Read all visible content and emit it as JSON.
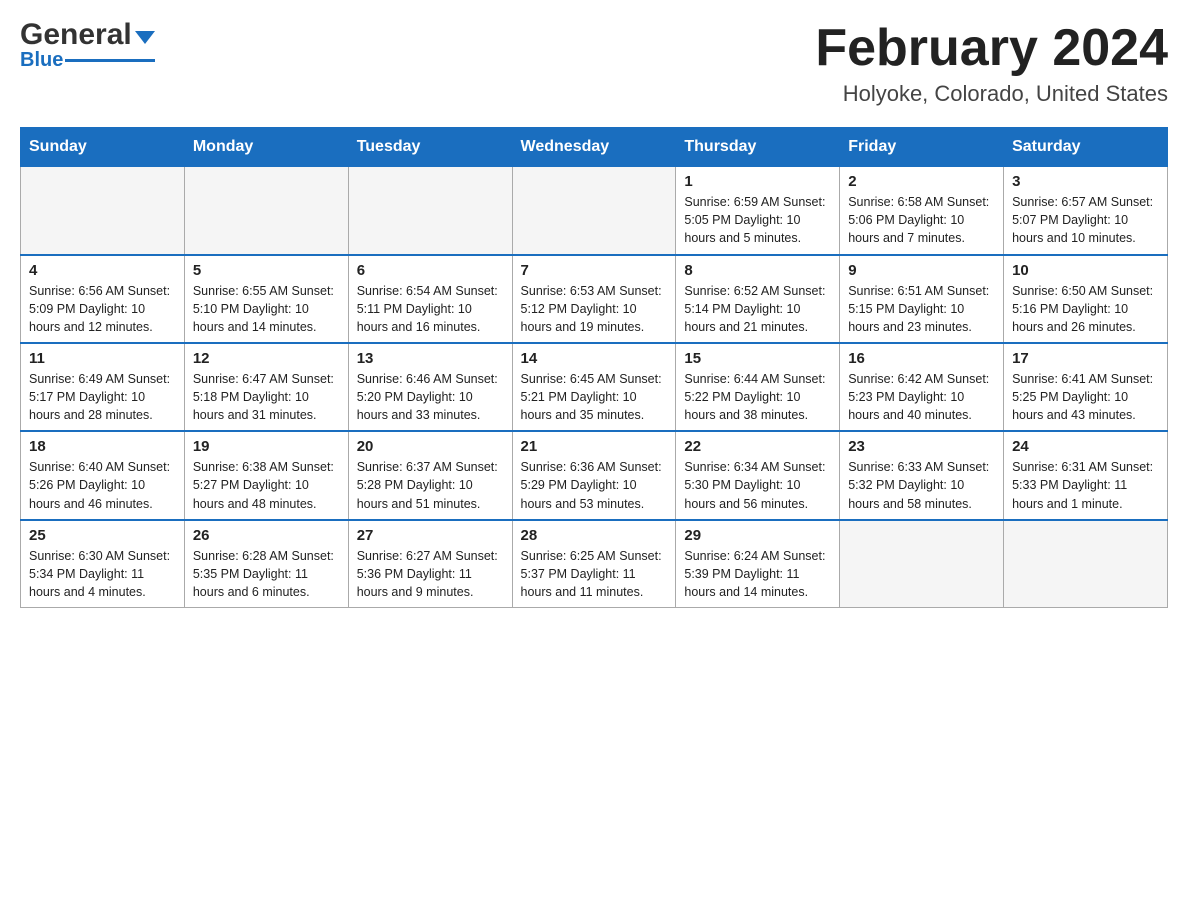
{
  "header": {
    "logo": {
      "general": "General",
      "blue": "Blue"
    },
    "title": "February 2024",
    "location": "Holyoke, Colorado, United States"
  },
  "weekdays": [
    "Sunday",
    "Monday",
    "Tuesday",
    "Wednesday",
    "Thursday",
    "Friday",
    "Saturday"
  ],
  "weeks": [
    [
      {
        "day": "",
        "info": ""
      },
      {
        "day": "",
        "info": ""
      },
      {
        "day": "",
        "info": ""
      },
      {
        "day": "",
        "info": ""
      },
      {
        "day": "1",
        "info": "Sunrise: 6:59 AM\nSunset: 5:05 PM\nDaylight: 10 hours\nand 5 minutes."
      },
      {
        "day": "2",
        "info": "Sunrise: 6:58 AM\nSunset: 5:06 PM\nDaylight: 10 hours\nand 7 minutes."
      },
      {
        "day": "3",
        "info": "Sunrise: 6:57 AM\nSunset: 5:07 PM\nDaylight: 10 hours\nand 10 minutes."
      }
    ],
    [
      {
        "day": "4",
        "info": "Sunrise: 6:56 AM\nSunset: 5:09 PM\nDaylight: 10 hours\nand 12 minutes."
      },
      {
        "day": "5",
        "info": "Sunrise: 6:55 AM\nSunset: 5:10 PM\nDaylight: 10 hours\nand 14 minutes."
      },
      {
        "day": "6",
        "info": "Sunrise: 6:54 AM\nSunset: 5:11 PM\nDaylight: 10 hours\nand 16 minutes."
      },
      {
        "day": "7",
        "info": "Sunrise: 6:53 AM\nSunset: 5:12 PM\nDaylight: 10 hours\nand 19 minutes."
      },
      {
        "day": "8",
        "info": "Sunrise: 6:52 AM\nSunset: 5:14 PM\nDaylight: 10 hours\nand 21 minutes."
      },
      {
        "day": "9",
        "info": "Sunrise: 6:51 AM\nSunset: 5:15 PM\nDaylight: 10 hours\nand 23 minutes."
      },
      {
        "day": "10",
        "info": "Sunrise: 6:50 AM\nSunset: 5:16 PM\nDaylight: 10 hours\nand 26 minutes."
      }
    ],
    [
      {
        "day": "11",
        "info": "Sunrise: 6:49 AM\nSunset: 5:17 PM\nDaylight: 10 hours\nand 28 minutes."
      },
      {
        "day": "12",
        "info": "Sunrise: 6:47 AM\nSunset: 5:18 PM\nDaylight: 10 hours\nand 31 minutes."
      },
      {
        "day": "13",
        "info": "Sunrise: 6:46 AM\nSunset: 5:20 PM\nDaylight: 10 hours\nand 33 minutes."
      },
      {
        "day": "14",
        "info": "Sunrise: 6:45 AM\nSunset: 5:21 PM\nDaylight: 10 hours\nand 35 minutes."
      },
      {
        "day": "15",
        "info": "Sunrise: 6:44 AM\nSunset: 5:22 PM\nDaylight: 10 hours\nand 38 minutes."
      },
      {
        "day": "16",
        "info": "Sunrise: 6:42 AM\nSunset: 5:23 PM\nDaylight: 10 hours\nand 40 minutes."
      },
      {
        "day": "17",
        "info": "Sunrise: 6:41 AM\nSunset: 5:25 PM\nDaylight: 10 hours\nand 43 minutes."
      }
    ],
    [
      {
        "day": "18",
        "info": "Sunrise: 6:40 AM\nSunset: 5:26 PM\nDaylight: 10 hours\nand 46 minutes."
      },
      {
        "day": "19",
        "info": "Sunrise: 6:38 AM\nSunset: 5:27 PM\nDaylight: 10 hours\nand 48 minutes."
      },
      {
        "day": "20",
        "info": "Sunrise: 6:37 AM\nSunset: 5:28 PM\nDaylight: 10 hours\nand 51 minutes."
      },
      {
        "day": "21",
        "info": "Sunrise: 6:36 AM\nSunset: 5:29 PM\nDaylight: 10 hours\nand 53 minutes."
      },
      {
        "day": "22",
        "info": "Sunrise: 6:34 AM\nSunset: 5:30 PM\nDaylight: 10 hours\nand 56 minutes."
      },
      {
        "day": "23",
        "info": "Sunrise: 6:33 AM\nSunset: 5:32 PM\nDaylight: 10 hours\nand 58 minutes."
      },
      {
        "day": "24",
        "info": "Sunrise: 6:31 AM\nSunset: 5:33 PM\nDaylight: 11 hours\nand 1 minute."
      }
    ],
    [
      {
        "day": "25",
        "info": "Sunrise: 6:30 AM\nSunset: 5:34 PM\nDaylight: 11 hours\nand 4 minutes."
      },
      {
        "day": "26",
        "info": "Sunrise: 6:28 AM\nSunset: 5:35 PM\nDaylight: 11 hours\nand 6 minutes."
      },
      {
        "day": "27",
        "info": "Sunrise: 6:27 AM\nSunset: 5:36 PM\nDaylight: 11 hours\nand 9 minutes."
      },
      {
        "day": "28",
        "info": "Sunrise: 6:25 AM\nSunset: 5:37 PM\nDaylight: 11 hours\nand 11 minutes."
      },
      {
        "day": "29",
        "info": "Sunrise: 6:24 AM\nSunset: 5:39 PM\nDaylight: 11 hours\nand 14 minutes."
      },
      {
        "day": "",
        "info": ""
      },
      {
        "day": "",
        "info": ""
      }
    ]
  ]
}
